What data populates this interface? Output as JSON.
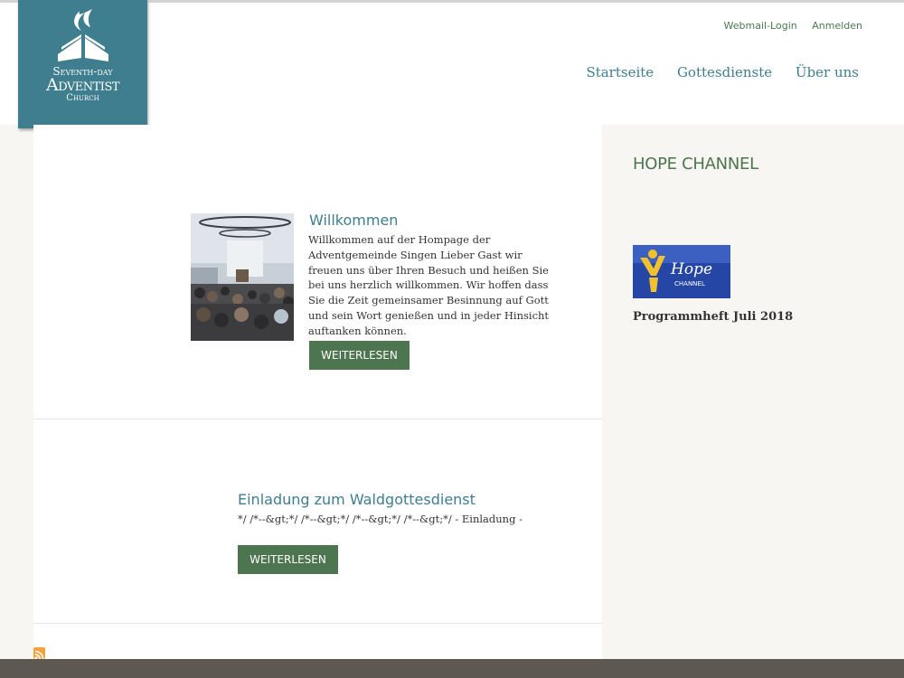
{
  "logo": {
    "line1": "Seventh-day",
    "line2": "Adventist",
    "line3": "Church"
  },
  "header": {
    "utility_links": [
      "Webmail-Login",
      "Anmelden"
    ],
    "nav": [
      "Startseite",
      "Gottesdienste",
      "Über uns"
    ]
  },
  "posts": [
    {
      "title": "Willkommen",
      "text": "Willkommen auf der Hompage der Adventgemeinde Singen   Lieber Gast wir freuen uns über Ihren Besuch und heißen Sie bei uns herzlich willkommen. Wir hoffen dass Sie die Zeit gemeinsamer Besinnung auf Gott und sein Wort genießen und in jeder Hinsicht auftanken können.",
      "button": "WEITERLESEN"
    },
    {
      "title": "Einladung zum Waldgottesdienst",
      "text": "*/ /*--&gt;*/ /*--&gt;*/ /*--&gt;*/ /*--&gt;*/ - Einladung -",
      "button": "WEITERLESEN"
    }
  ],
  "sidebar": {
    "title": "HOPE CHANNEL",
    "logo_text": "Hope",
    "logo_sub": "CHANNEL",
    "link": "Programmheft Juli 2018"
  },
  "colors": {
    "teal": "#3f7e8e",
    "green": "#4d7550",
    "footer": "#5d5852"
  }
}
